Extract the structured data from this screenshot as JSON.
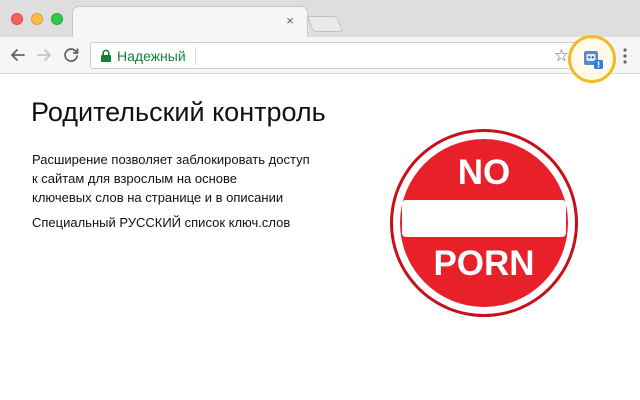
{
  "browser": {
    "window_controls": [
      "close",
      "minimize",
      "maximize"
    ],
    "tab": {
      "close_glyph": "×"
    },
    "address_bar": {
      "secure_label": "Надежный"
    },
    "colors": {
      "secure": "#188038",
      "highlight_ring": "#f2b928"
    }
  },
  "page": {
    "title": "Родительский контроль",
    "description_lines": [
      "Расширение позволяет заблокировать доступ",
      "к сайтам для взрослым на основе",
      "ключевых слов на странице и в описании"
    ],
    "list_note": "Специальный РУССКИЙ список ключ.слов"
  },
  "sign": {
    "top_text": "NO",
    "bottom_text": "PORN",
    "colors": {
      "fill": "#e8202a",
      "ring": "#ffffff",
      "outline": "#c8101a",
      "bar": "#ffffff"
    }
  }
}
